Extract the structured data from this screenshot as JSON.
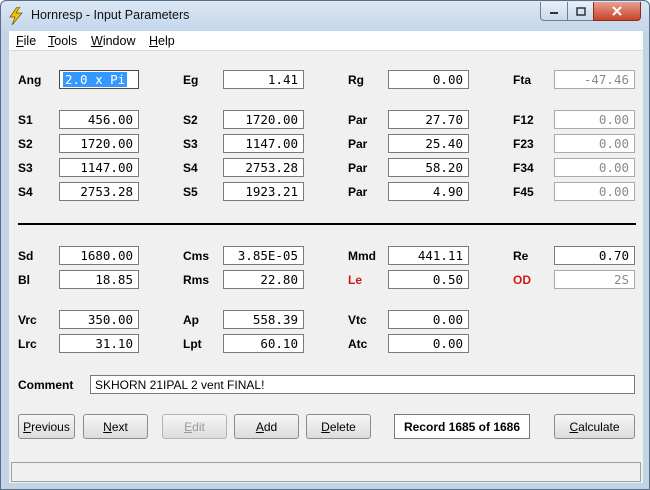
{
  "window": {
    "title": "Hornresp - Input Parameters"
  },
  "menu": [
    {
      "u": "F",
      "rest": "ile"
    },
    {
      "u": "T",
      "rest": "ools"
    },
    {
      "u": "W",
      "rest": "indow"
    },
    {
      "u": "H",
      "rest": "elp"
    }
  ],
  "fields": {
    "ang": {
      "label": "Ang",
      "value": "2.0 x Pi"
    },
    "eg": {
      "label": "Eg",
      "value": "1.41"
    },
    "rg": {
      "label": "Rg",
      "value": "0.00"
    },
    "fta": {
      "label": "Fta",
      "value": "-47.46"
    },
    "s1": {
      "label": "S1",
      "value": "456.00"
    },
    "s2a": {
      "label": "S2",
      "value": "1720.00"
    },
    "par1": {
      "label": "Par",
      "value": "27.70"
    },
    "f12": {
      "label": "F12",
      "value": "0.00"
    },
    "s2b": {
      "label": "S2",
      "value": "1720.00"
    },
    "s3a": {
      "label": "S3",
      "value": "1147.00"
    },
    "par2": {
      "label": "Par",
      "value": "25.40"
    },
    "f23": {
      "label": "F23",
      "value": "0.00"
    },
    "s3b": {
      "label": "S3",
      "value": "1147.00"
    },
    "s4a": {
      "label": "S4",
      "value": "2753.28"
    },
    "par3": {
      "label": "Par",
      "value": "58.20"
    },
    "f34": {
      "label": "F34",
      "value": "0.00"
    },
    "s4b": {
      "label": "S4",
      "value": "2753.28"
    },
    "s5": {
      "label": "S5",
      "value": "1923.21"
    },
    "par4": {
      "label": "Par",
      "value": "4.90"
    },
    "f45": {
      "label": "F45",
      "value": "0.00"
    },
    "sd": {
      "label": "Sd",
      "value": "1680.00"
    },
    "cms": {
      "label": "Cms",
      "value": "3.85E-05"
    },
    "mmd": {
      "label": "Mmd",
      "value": "441.11"
    },
    "re": {
      "label": "Re",
      "value": "0.70"
    },
    "bl": {
      "label": "Bl",
      "value": "18.85"
    },
    "rms": {
      "label": "Rms",
      "value": "22.80"
    },
    "le": {
      "label": "Le",
      "value": "0.50"
    },
    "od": {
      "label": "OD",
      "value": "2S"
    },
    "vrc": {
      "label": "Vrc",
      "value": "350.00"
    },
    "ap": {
      "label": "Ap",
      "value": "558.39"
    },
    "vtc": {
      "label": "Vtc",
      "value": "0.00"
    },
    "lrc": {
      "label": "Lrc",
      "value": "31.10"
    },
    "lpt": {
      "label": "Lpt",
      "value": "60.10"
    },
    "atc": {
      "label": "Atc",
      "value": "0.00"
    }
  },
  "comment": {
    "label": "Comment",
    "value": "SKHORN 21IPAL 2 vent FINAL!"
  },
  "buttons": {
    "previous": {
      "u": "P",
      "rest": "revious"
    },
    "next": {
      "u": "N",
      "rest": "ext"
    },
    "edit": {
      "u": "E",
      "rest": "dit"
    },
    "add": {
      "u": "A",
      "rest": "dd"
    },
    "delete": {
      "u": "D",
      "rest": "elete"
    },
    "calculate": {
      "u": "C",
      "rest": "alculate"
    }
  },
  "record": "Record 1685 of 1686",
  "colors": {
    "title_bg": "#c4d6ea",
    "client_bg": "#f0f0f0",
    "warning_label": "#cc1a1a",
    "selection": "#3399ff",
    "close_button": "#c7442a"
  },
  "icons": {
    "app": "lightning-bolt-icon",
    "minimize": "minimize-icon",
    "maximize": "maximize-icon",
    "close": "close-icon"
  }
}
